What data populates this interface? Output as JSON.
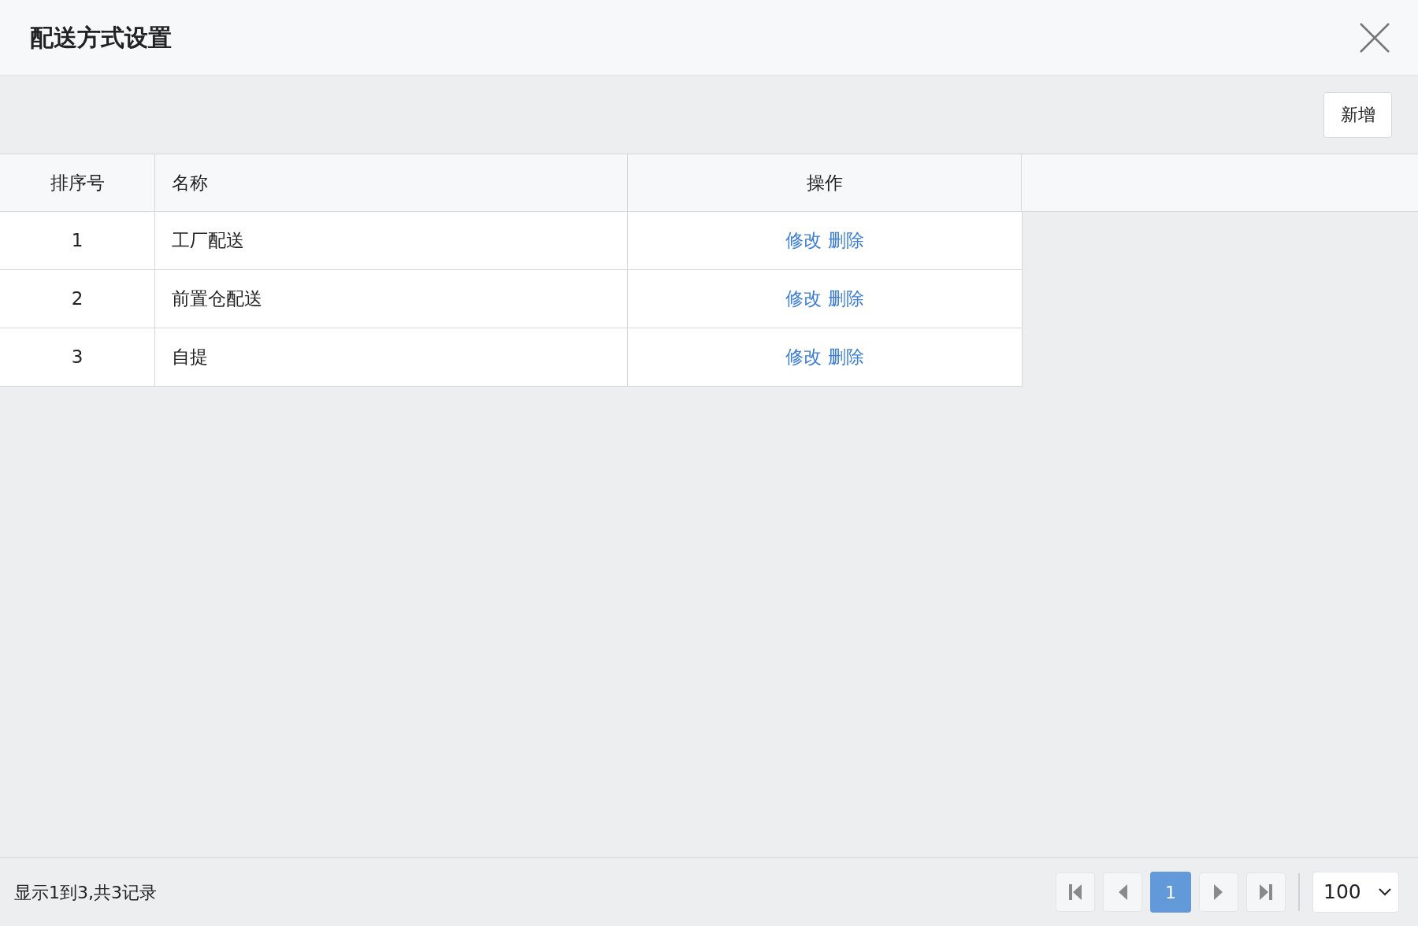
{
  "dialog": {
    "title": "配送方式设置"
  },
  "toolbar": {
    "add_button": "新增"
  },
  "table": {
    "columns": [
      "排序号",
      "名称",
      "操作"
    ],
    "rows": [
      {
        "order": "1",
        "name": "工厂配送",
        "actions": [
          "修改",
          "删除"
        ]
      },
      {
        "order": "2",
        "name": "前置仓配送",
        "actions": [
          "修改",
          "删除"
        ]
      },
      {
        "order": "3",
        "name": "自提",
        "actions": [
          "修改",
          "删除"
        ]
      }
    ]
  },
  "footer": {
    "summary": "显示1到3,共3记录",
    "pages": [
      {
        "label": "1",
        "selected": true
      }
    ],
    "page_size": "100"
  }
}
